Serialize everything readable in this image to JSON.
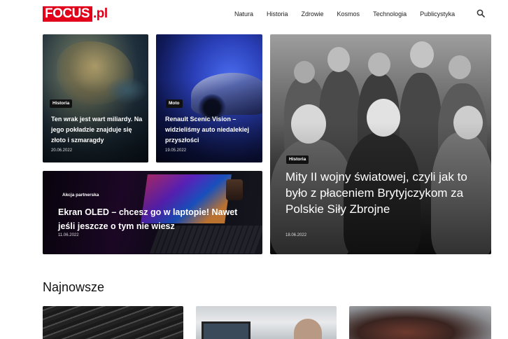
{
  "header": {
    "logo_main": "FOCUS",
    "logo_suffix": ".pl",
    "nav": [
      "Natura",
      "Historia",
      "Zdrowie",
      "Kosmos",
      "Technologia",
      "Publicystyka"
    ]
  },
  "featured": [
    {
      "badge": "Historia",
      "title": "Ten wrak jest wart miliardy. Na jego pokładzie znajduje się złoto i szmaragdy",
      "date": "20.06.2022"
    },
    {
      "badge": "Moto",
      "title": "Renault Scenic Vision – widzieliśmy auto niedalekiej przyszłości",
      "date": "19.05.2022"
    },
    {
      "badge": "Akcja partnerska",
      "title": "Ekran OLED – chcesz go w laptopie! Nawet jeśli jeszcze o tym nie wiesz",
      "date": "11.06.2022"
    },
    {
      "badge": "Historia",
      "title": "Mity II wojny światowej, czyli jak to było z płaceniem Brytyjczykom za Polskie Siły Zbrojne",
      "date": "18.06.2022"
    }
  ],
  "latest": {
    "heading": "Najnowsze"
  },
  "colors": {
    "brand": "#e2001a",
    "badge_bg": "#111111"
  },
  "icons": {
    "search": "search-icon"
  }
}
